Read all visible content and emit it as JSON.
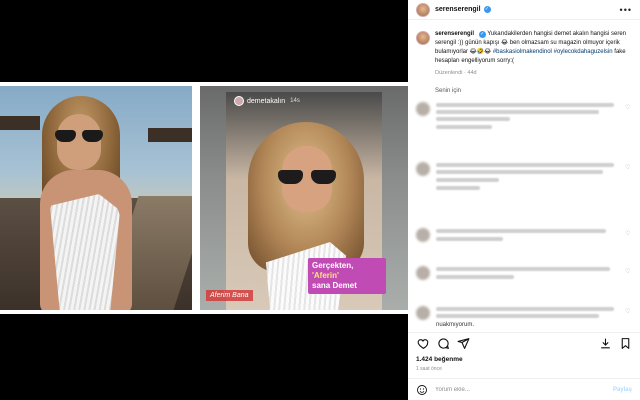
{
  "post": {
    "username": "serenserengil",
    "verified": true,
    "more_icon": "more-dots-icon"
  },
  "caption": {
    "username": "serenserengil",
    "text_1": "Yukarıdakilerden hangisi demet akalın hangisi seren serengil :)) günün kapışı",
    "text_2": "ben olmazsam su magazin olmuyor içerik bulamıyorlar",
    "hashtag_1": "#baskasiolmakendinol",
    "hashtag_2": "#oylecokdahaguzelsin",
    "text_3": "fake hesapları engelliyorum sorry:(",
    "edited": "Düzenlendi · 44d"
  },
  "comments_header": "Senin için",
  "photo_right": {
    "story_user": "demetakalın",
    "story_time": "14s",
    "sticker_main_1": "Gerçekten, ",
    "sticker_main_hl": "'Aferin'",
    "sticker_main_2": "sana Demet",
    "sticker_left": "Aferim Bana"
  },
  "comment_tail": "nuakmıyorum.",
  "likes": "1.424 beğenme",
  "time_ago": "1 saat önce",
  "comment_input_placeholder": "Yorum ekle...",
  "post_button": "Paylaş",
  "icons": {
    "like": "heart-icon",
    "comment": "comment-icon",
    "share": "send-icon",
    "save": "bookmark-icon",
    "emoji": "emoji-icon"
  },
  "colors": {
    "link": "#00376b",
    "verified": "#3897f0",
    "muted": "#8e8e8e"
  }
}
